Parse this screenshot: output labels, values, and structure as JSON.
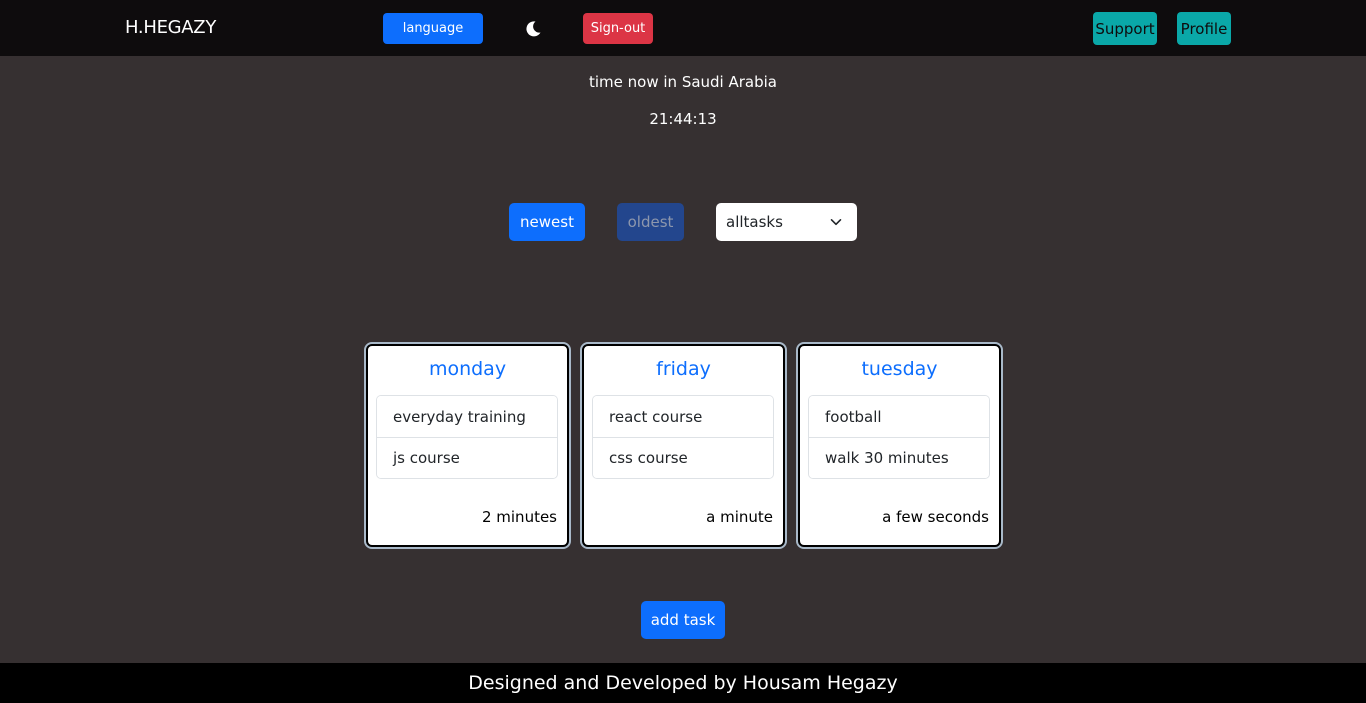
{
  "navbar": {
    "brand": "H.HEGAZY",
    "language_label": "language",
    "theme_icon": "moon-icon",
    "signout_label": "Sign-out",
    "support_label": "Support",
    "profile_label": "Profile"
  },
  "clock": {
    "label": "time now in Saudi Arabia",
    "value": "21:44:13"
  },
  "controls": {
    "newest_label": "newest",
    "oldest_label": "oldest",
    "filter_selected": "alltasks"
  },
  "cards": [
    {
      "day": "monday",
      "tasks": [
        "everyday training",
        "js course"
      ],
      "time_ago": "2 minutes"
    },
    {
      "day": "friday",
      "tasks": [
        "react course",
        "css course"
      ],
      "time_ago": "a minute"
    },
    {
      "day": "tuesday",
      "tasks": [
        "football",
        "walk 30 minutes"
      ],
      "time_ago": "a few seconds"
    }
  ],
  "add_task_label": "add task",
  "footer": {
    "text": "Designed and Developed by Housam Hegazy"
  },
  "colors": {
    "background": "#363031",
    "navbar": "#0e0c0d",
    "primary": "#0d6efd",
    "danger": "#dc3545",
    "teal": "#0aa8a8",
    "footer": "#000000"
  }
}
